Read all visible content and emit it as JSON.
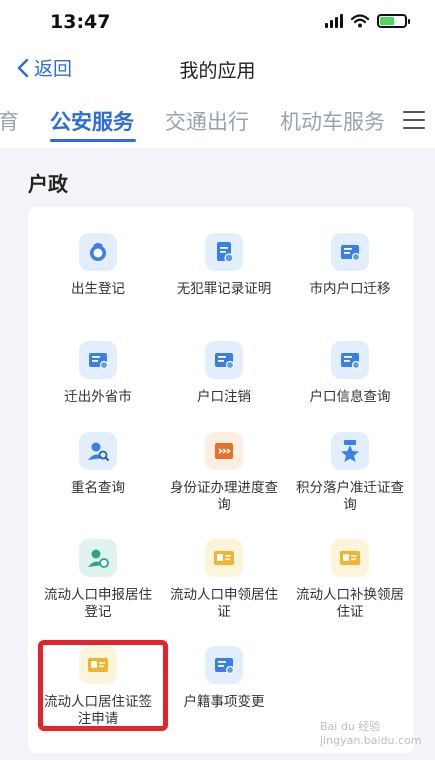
{
  "status_bar": {
    "time": "13:47"
  },
  "nav": {
    "back_label": "返回",
    "title": "我的应用"
  },
  "tabs": [
    {
      "label": "育",
      "active": false
    },
    {
      "label": "公安服务",
      "active": true
    },
    {
      "label": "交通出行",
      "active": false
    },
    {
      "label": "机动车服务",
      "active": false
    }
  ],
  "section": {
    "title": "户政"
  },
  "apps": [
    {
      "label": "出生登记",
      "icon": "baby-icon",
      "color": "blue"
    },
    {
      "label": "无犯罪记录证明",
      "icon": "document-icon",
      "color": "blue"
    },
    {
      "label": "市内户口迁移",
      "icon": "household-card-icon",
      "color": "blue"
    },
    {
      "label": "迁出外省市",
      "icon": "household-card-icon",
      "color": "blue"
    },
    {
      "label": "户口注销",
      "icon": "household-card-icon",
      "color": "blue"
    },
    {
      "label": "户口信息查询",
      "icon": "household-card-icon",
      "color": "blue"
    },
    {
      "label": "重名查询",
      "icon": "person-search-icon",
      "color": "blue"
    },
    {
      "label": "身份证办理进度查询",
      "icon": "progress-icon",
      "color": "orange"
    },
    {
      "label": "积分落户准迁证查询",
      "icon": "star-badge-icon",
      "color": "blue"
    },
    {
      "label": "流动人口申报居住登记",
      "icon": "person-refresh-icon",
      "color": "teal"
    },
    {
      "label": "流动人口申领居住证",
      "icon": "id-card-icon",
      "color": "yellow"
    },
    {
      "label": "流动人口补换领居住证",
      "icon": "id-card-icon",
      "color": "yellow"
    },
    {
      "label": "流动人口居住证签注申请",
      "icon": "id-card-icon",
      "color": "yellow"
    },
    {
      "label": "户籍事项变更",
      "icon": "household-card-icon",
      "color": "blue"
    }
  ],
  "colors": {
    "accent": "#2d6cdf",
    "highlight": "#e5232a"
  },
  "watermark": {
    "text": "Bai du 经验",
    "url": "jingyan.baidu.com"
  }
}
